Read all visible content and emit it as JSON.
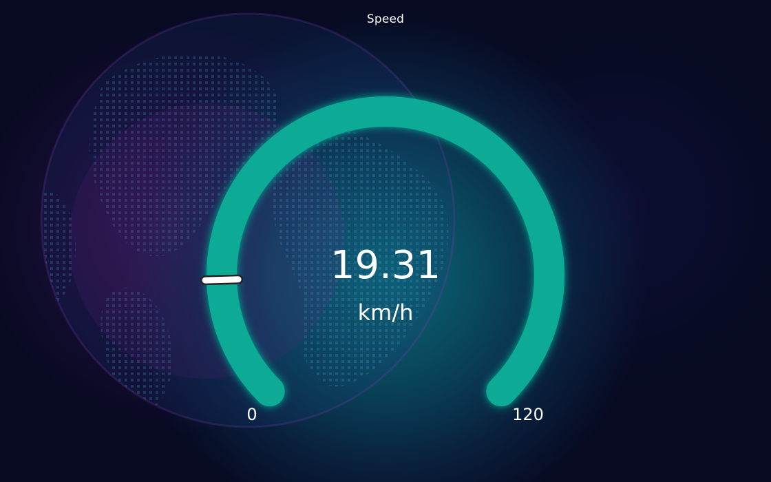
{
  "title": "Speed",
  "gauge": {
    "value": 19.31,
    "value_text": "19.31",
    "unit": "km/h",
    "min": 0,
    "max": 120,
    "min_label": "0",
    "max_label": "120",
    "track_color": "#0aaa95",
    "pointer_color": "#ffffff"
  },
  "colors": {
    "background": "#070a22",
    "glow_teal": "#0d6e7d",
    "glow_purple": "#6e1978",
    "text": "#ffffff"
  }
}
